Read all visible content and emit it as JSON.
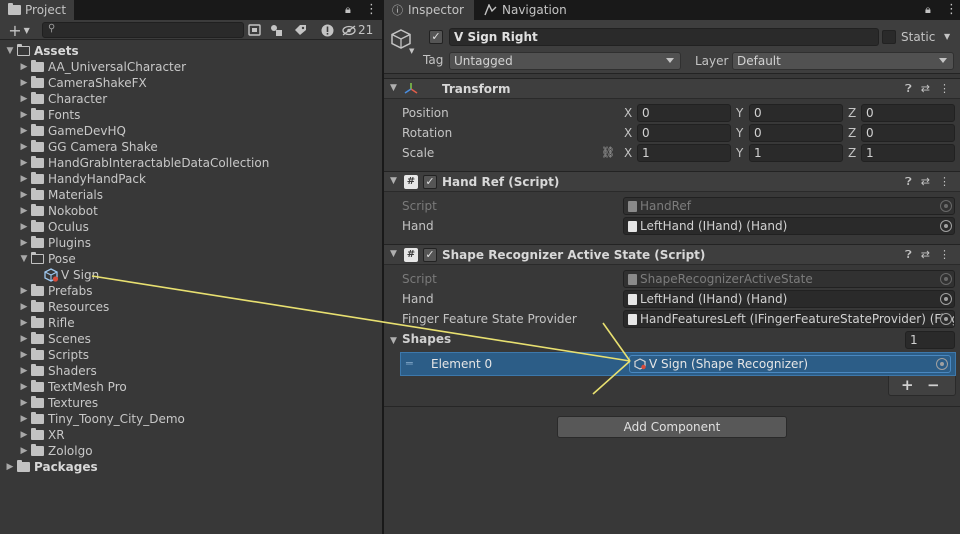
{
  "project": {
    "tab_label": "Project",
    "hidden_count": "21",
    "add_label": "+",
    "tree": {
      "assets_label": "Assets",
      "folders": [
        "AA_UniversalCharacter",
        "CameraShakeFX",
        "Character",
        "Fonts",
        "GameDevHQ",
        "GG Camera Shake",
        "HandGrabInteractableDataCollection",
        "HandyHandPack",
        "Materials",
        "Nokobot",
        "Oculus",
        "Plugins"
      ],
      "pose_label": "Pose",
      "pose_child": "V Sign",
      "folders_after": [
        "Prefabs",
        "Resources",
        "Rifle",
        "Scenes",
        "Scripts",
        "Shaders",
        "TextMesh Pro",
        "Textures",
        "Tiny_Toony_City_Demo",
        "XR",
        "Zololgo"
      ],
      "packages_label": "Packages"
    }
  },
  "inspector": {
    "tab_inspector": "Inspector",
    "tab_navigation": "Navigation",
    "object_name": "V Sign Right",
    "static_label": "Static",
    "tag_label": "Tag",
    "tag_value": "Untagged",
    "layer_label": "Layer",
    "layer_value": "Default",
    "transform": {
      "title": "Transform",
      "position_label": "Position",
      "rotation_label": "Rotation",
      "scale_label": "Scale",
      "axis_x": "X",
      "axis_y": "Y",
      "axis_z": "Z",
      "position": [
        "0",
        "0",
        "0"
      ],
      "rotation": [
        "0",
        "0",
        "0"
      ],
      "scale": [
        "1",
        "1",
        "1"
      ]
    },
    "hand_ref": {
      "title": "Hand Ref (Script)",
      "script_label": "Script",
      "script_value": "HandRef",
      "hand_label": "Hand",
      "hand_value": "LeftHand (IHand) (Hand)"
    },
    "shape_recognizer": {
      "title": "Shape Recognizer Active State (Script)",
      "script_label": "Script",
      "script_value": "ShapeRecognizerActiveState",
      "hand_label": "Hand",
      "hand_value": "LeftHand (IHand) (Hand)",
      "finger_label": "Finger Feature State Provider",
      "finger_value": "HandFeaturesLeft (IFingerFeatureStateProvider) (Fing",
      "shapes_label": "Shapes",
      "shapes_count": "1",
      "element_label": "Element 0",
      "element_value": "V Sign (Shape Recognizer)",
      "add_element": "+",
      "remove_element": "−"
    },
    "add_component": "Add Component"
  },
  "colors": {
    "selection": "#2c5d87",
    "annotation": "#e8e070"
  }
}
